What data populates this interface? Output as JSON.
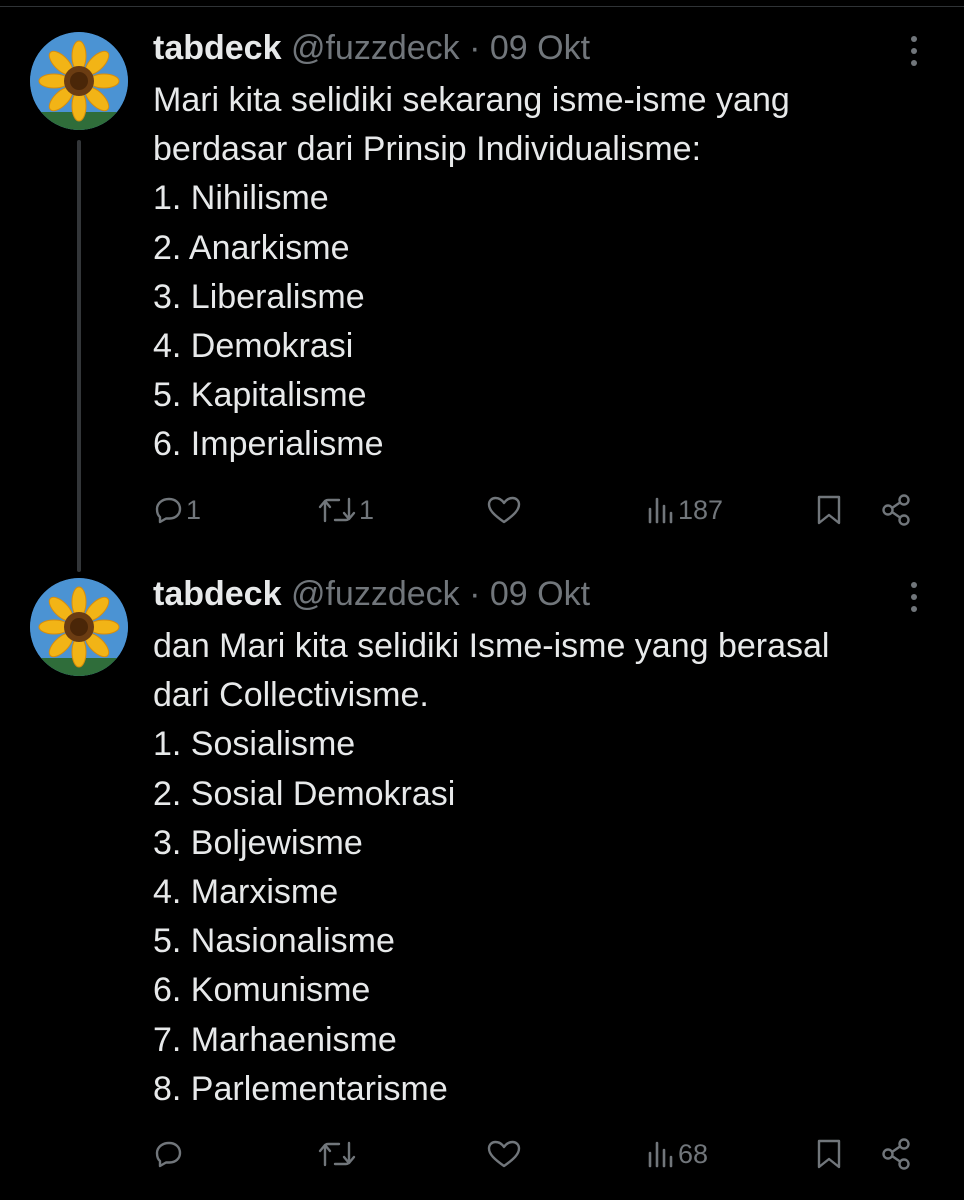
{
  "colors": {
    "background": "#000000",
    "text_primary": "#e7e9ea",
    "text_secondary": "#71767b",
    "thread_line": "#333639"
  },
  "tweets": [
    {
      "avatar_icon": "sunflower-avatar-icon",
      "display_name": "tabdeck",
      "handle": "@fuzzdeck",
      "separator": "·",
      "date": "09 Okt",
      "lines": [
        "Mari kita selidiki sekarang isme-isme yang",
        "berdasar dari  Prinsip Individualisme:",
        "1. Nihilisme",
        "2. Anarkisme",
        "3. Liberalisme",
        "4. Demokrasi",
        "5. Kapitalisme",
        "6. Imperialisme"
      ],
      "actions": {
        "reply_count": "1",
        "repost_count": "1",
        "like_count": "",
        "views_count": "187"
      }
    },
    {
      "avatar_icon": "sunflower-avatar-icon",
      "display_name": "tabdeck",
      "handle": "@fuzzdeck",
      "separator": "·",
      "date": "09 Okt",
      "lines": [
        "dan Mari kita selidiki Isme-isme yang berasal",
        "dari Collectivisme.",
        "1. Sosialisme",
        "2. Sosial Demokrasi",
        "3. Boljewisme",
        "4. Marxisme",
        "5. Nasionalisme",
        "6. Komunisme",
        "7. Marhaenisme",
        "8. Parlementarisme"
      ],
      "actions": {
        "reply_count": "",
        "repost_count": "",
        "like_count": "",
        "views_count": "68"
      }
    }
  ]
}
